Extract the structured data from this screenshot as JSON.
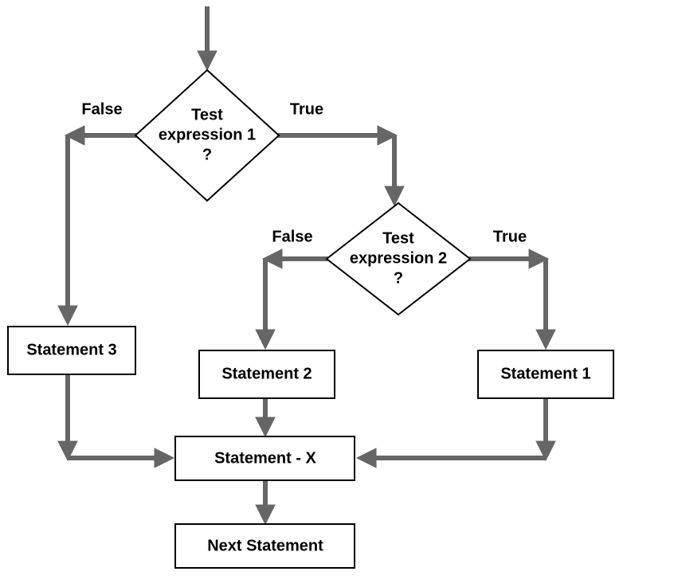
{
  "diagram": {
    "type": "flowchart",
    "nodes": {
      "decision1": {
        "line1": "Test",
        "line2": "expression 1",
        "line3": "?"
      },
      "decision2": {
        "line1": "Test",
        "line2": "expression 2",
        "line3": "?"
      },
      "stmt1": "Statement 1",
      "stmt2": "Statement 2",
      "stmt3": "Statement 3",
      "stmtX": "Statement - X",
      "next": "Next Statement"
    },
    "edges": {
      "d1_false": "False",
      "d1_true": "True",
      "d2_false": "False",
      "d2_true": "True"
    }
  }
}
